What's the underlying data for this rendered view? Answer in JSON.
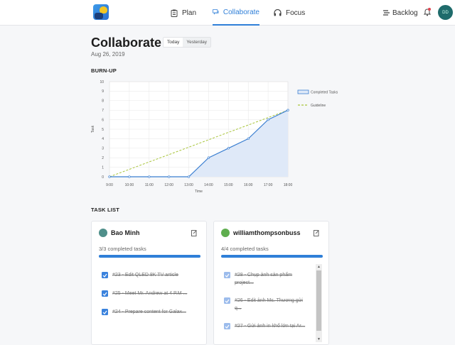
{
  "nav": {
    "items": [
      {
        "label": "Plan",
        "icon": "clipboard-icon"
      },
      {
        "label": "Collaborate",
        "icon": "chat-icon"
      },
      {
        "label": "Focus",
        "icon": "headphones-icon"
      }
    ],
    "backlog_label": "Backlog",
    "avatar_initials": "DD",
    "accent": "#2f7fd8",
    "notification_color": "#e0434f"
  },
  "header": {
    "title": "Collaborate",
    "date": "Aug 26, 2019",
    "segments": [
      "Today",
      "Yesterday"
    ],
    "active_segment": "Today"
  },
  "burnup": {
    "section_label": "BURN-UP"
  },
  "chart_data": {
    "type": "line",
    "title": "",
    "xlabel": "Time",
    "ylabel": "Task",
    "x": [
      "9:00",
      "10:00",
      "11:00",
      "12:00",
      "13:00",
      "14:00",
      "15:00",
      "16:00",
      "17:00",
      "18:00"
    ],
    "ylim": [
      0,
      10
    ],
    "yticks": [
      0,
      1,
      2,
      3,
      4,
      5,
      6,
      7,
      8,
      9,
      10
    ],
    "grid": true,
    "legend_position": "right",
    "series": [
      {
        "name": "Completed Tasks",
        "values": [
          0,
          0,
          0,
          0,
          0,
          2,
          3,
          4,
          6,
          7
        ],
        "color": "#3b7fd1",
        "fill": "#dfe9f8",
        "style": "solid-area"
      },
      {
        "name": "Guideline",
        "values": [
          0,
          0.78,
          1.56,
          2.33,
          3.11,
          3.89,
          4.67,
          5.44,
          6.22,
          7
        ],
        "color": "#a8c43a",
        "style": "dashed"
      }
    ]
  },
  "task_list": {
    "section_label": "TASK LIST",
    "cards": [
      {
        "name": "Bao Minh",
        "count_text": "3/3 completed tasks",
        "progress": 1.0,
        "tasks": [
          "#23 - Edit QLED 8K TV article",
          "#25 - Meet Mr. Andrew at 4 P.M ...",
          "#24 - Prepare content for Galax..."
        ]
      },
      {
        "name": "williamthompsonbussi...",
        "count_text": "4/4 completed tasks",
        "progress": 1.0,
        "tasks": [
          "#28 - Chụp ảnh sản phẩm project...",
          "#26 - Edit ảnh Ms. Thương gửi q...",
          "#27 - Gửi ảnh in khổ lớn tại Ar..."
        ]
      }
    ]
  }
}
